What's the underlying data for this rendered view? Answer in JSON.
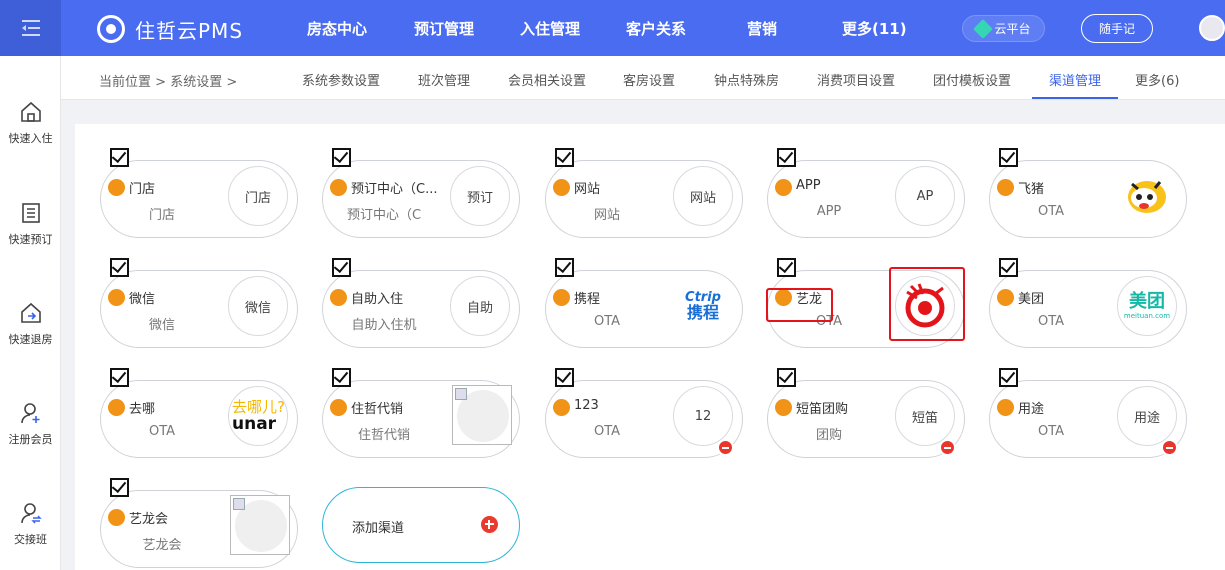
{
  "brand": {
    "name": "住哲云PMS"
  },
  "topnav": [
    "房态中心",
    "预订管理",
    "入住管理",
    "客户关系",
    "营销",
    "更多(11)"
  ],
  "cloud_label": "云平台",
  "note_label": "随手记",
  "sidebar": [
    {
      "label": "快速入住",
      "icon": "home-icon"
    },
    {
      "label": "快速预订",
      "icon": "list-icon"
    },
    {
      "label": "快速退房",
      "icon": "checkout-icon"
    },
    {
      "label": "注册会员",
      "icon": "add-user-icon"
    },
    {
      "label": "交接班",
      "icon": "shift-icon"
    }
  ],
  "breadcrumb": {
    "prefix": "当前位置",
    "sep1": ">",
    "section": "系统设置",
    "sep2": ">"
  },
  "subtabs": [
    "系统参数设置",
    "班次管理",
    "会员相关设置",
    "客房设置",
    "钟点特殊房",
    "消费项目设置",
    "团付模板设置",
    "渠道管理",
    "更多(6)"
  ],
  "active_subtab": "渠道管理",
  "channels": [
    {
      "name": "门店",
      "type": "门店",
      "badge": "门店"
    },
    {
      "name": "预订中心（C...",
      "type": "预订中心（C",
      "badge": "预订"
    },
    {
      "name": "网站",
      "type": "网站",
      "badge": "网站"
    },
    {
      "name": "APP",
      "type": "APP",
      "badge": "AP"
    },
    {
      "name": "飞猪",
      "type": "OTA",
      "badge": "",
      "logo": "fliggy-logo"
    },
    {
      "name": "微信",
      "type": "微信",
      "badge": "微信"
    },
    {
      "name": "自助入住",
      "type": "自助入住机",
      "badge": "自助"
    },
    {
      "name": "携程",
      "type": "OTA",
      "badge": "",
      "logo": "ctrip-logo",
      "logo_text_top": "Ctrip",
      "logo_text_bottom": "携程"
    },
    {
      "name": "艺龙",
      "type": "OTA",
      "badge": "",
      "logo": "elong-logo"
    },
    {
      "name": "美团",
      "type": "OTA",
      "badge": "",
      "logo": "meituan-logo",
      "logo_text_top": "美团",
      "logo_text_bottom": "meituan.com"
    },
    {
      "name": "去哪",
      "type": "OTA",
      "badge": "",
      "logo": "qunar-logo",
      "logo_text_top": "去哪儿?",
      "logo_text_bottom": "unar"
    },
    {
      "name": "住哲代销",
      "type": "住哲代销",
      "badge": "",
      "logo": "broken-image"
    },
    {
      "name": "123",
      "type": "OTA",
      "badge": "12"
    },
    {
      "name": "短笛团购",
      "type": "团购",
      "badge": "短笛"
    },
    {
      "name": "用途",
      "type": "OTA",
      "badge": "用途"
    },
    {
      "name": "艺龙会",
      "type": "艺龙会",
      "badge": "",
      "logo": "broken-image"
    }
  ],
  "add_channel_label": "添加渠道",
  "colors": {
    "header": "#4a6cf0",
    "accent": "#3b63e8",
    "status_dot": "#f09317",
    "delete": "#e8362d",
    "highlight": "#e3151b"
  }
}
